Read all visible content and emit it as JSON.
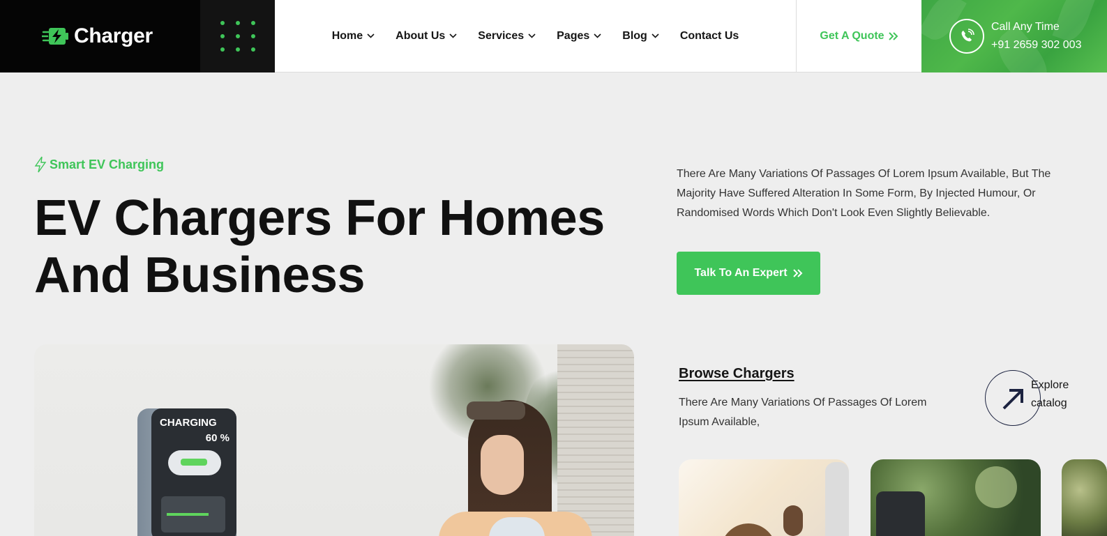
{
  "header": {
    "logo_text": "Charger",
    "nav": [
      {
        "label": "Home",
        "dropdown": true
      },
      {
        "label": "About Us",
        "dropdown": true
      },
      {
        "label": "Services",
        "dropdown": true
      },
      {
        "label": "Pages",
        "dropdown": true
      },
      {
        "label": "Blog",
        "dropdown": true
      },
      {
        "label": "Contact Us",
        "dropdown": false
      }
    ],
    "quote_label": "Get A Quote",
    "call_label": "Call Any Time",
    "call_number": "+91 2659 302 003"
  },
  "hero": {
    "tagline": "Smart EV Charging",
    "title_line1": "EV Chargers For Homes",
    "title_line2": "And Business",
    "description": "There Are Many Variations Of Passages Of Lorem Ipsum Available, But The Majority Have Suffered Alteration In Some Form, By Injected Humour, Or Randomised Words Which Don't Look Even Slightly Believable.",
    "cta_label": "Talk To An Expert",
    "charger_screen_title": "CHARGING",
    "charger_screen_pct": "60 %"
  },
  "browse": {
    "title": "Browse Chargers",
    "description": "There Are Many Variations Of Passages Of Lorem Ipsum Available,",
    "explore_line1": "Explore",
    "explore_line2": "catalog"
  },
  "colors": {
    "accent": "#3fc559",
    "dark": "#050505",
    "background": "#eeeeee",
    "navy": "#1c2340"
  },
  "icons": {
    "logo": "lightning-plug-icon",
    "nav_dropdown": "chevron-down-icon",
    "quote": "double-chevron-right-icon",
    "call": "phone-ringing-icon",
    "tagline": "lightning-icon",
    "cta": "double-chevron-right-icon",
    "explore": "arrow-up-right-icon"
  }
}
